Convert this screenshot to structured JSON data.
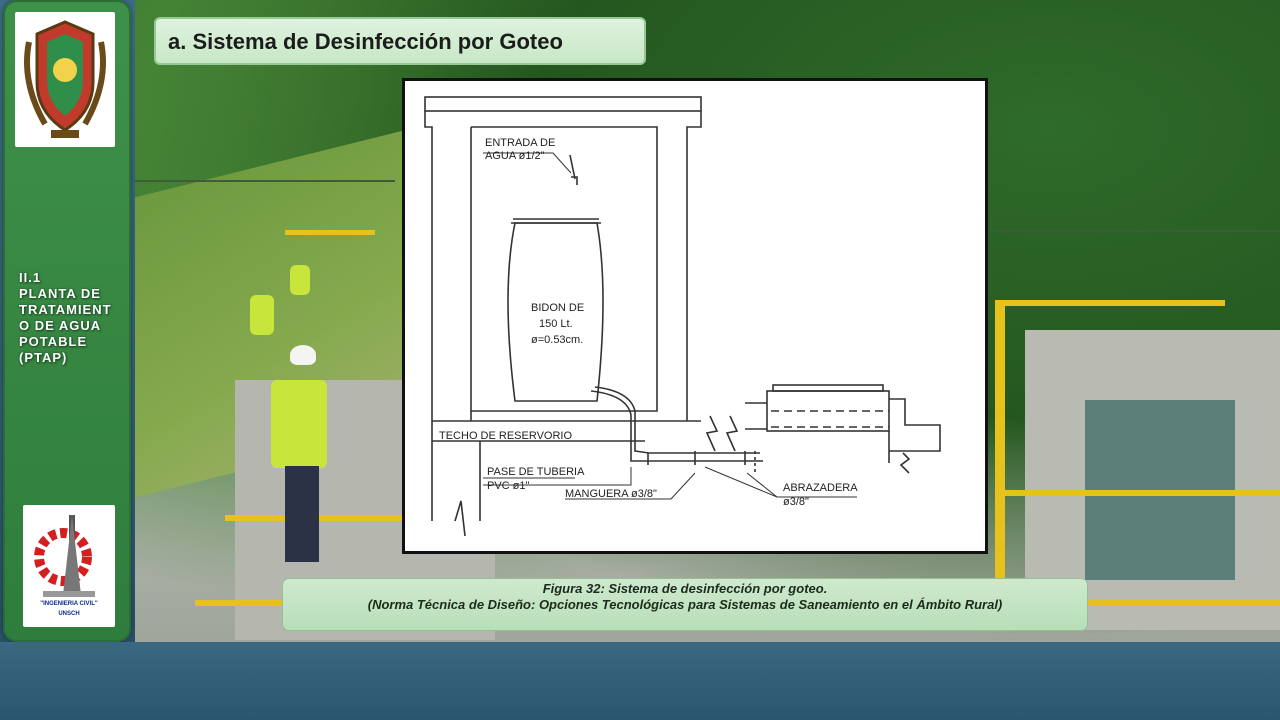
{
  "slide": {
    "title": "a.  Sistema de Desinfección por Goteo",
    "section_label": "II.1\nPLANTA DE\nTRATAMIENT\nO DE AGUA\nPOTABLE\n(PTAP)",
    "bottom_logo_caption_1": "\"INGENIERIA CIVIL\"",
    "bottom_logo_caption_2": "UNSCH"
  },
  "figure": {
    "labels": {
      "entrada_1": "ENTRADA DE",
      "entrada_2": "AGUA ø1/2\"",
      "bidon_1": "BIDON DE",
      "bidon_2": "150 Lt.",
      "bidon_3": "ø=0.53cm.",
      "techo": "TECHO DE RESERVORIO",
      "pase_1": "PASE DE TUBERIA",
      "pase_2": "PVC ø1\"",
      "manguera": "MANGUERA ø3/8\"",
      "abrazadera_1": "ABRAZADERA",
      "abrazadera_2": "ø3/8\""
    }
  },
  "caption": {
    "line1": "Figura 32: Sistema de desinfección por goteo.",
    "line2": "(Norma Técnica de Diseño: Opciones Tecnológicas para Sistemas de Saneamiento en el Ámbito Rural)"
  },
  "colors": {
    "sidebar": "#3f9149",
    "title_bg": "#d4eed3",
    "caption_bg": "#c4e4c3",
    "bottom_band": "#2f5a74"
  }
}
